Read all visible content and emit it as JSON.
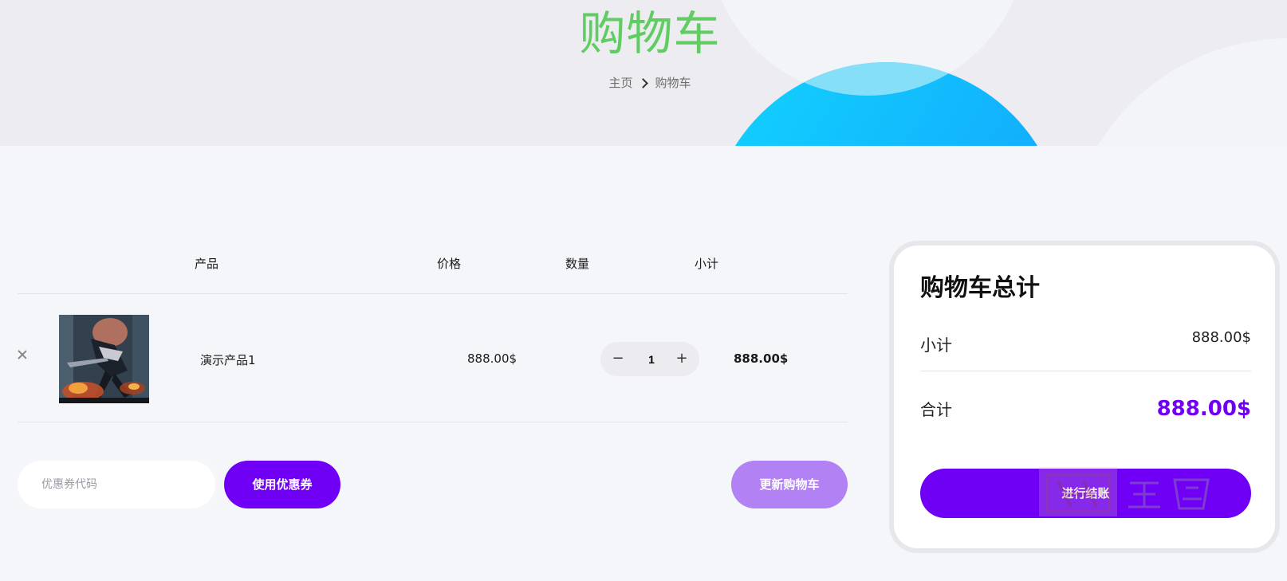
{
  "hero": {
    "title": "购物车",
    "breadcrumb": {
      "home": "主页",
      "current": "购物车"
    }
  },
  "cart": {
    "columns": {
      "product": "产品",
      "price": "价格",
      "quantity": "数量",
      "subtotal": "小计"
    },
    "items": [
      {
        "name": "演示产品1",
        "price": "888.00$",
        "quantity": "1",
        "subtotal": "888.00$"
      }
    ],
    "quantity_minus": "−",
    "quantity_plus": "+",
    "coupon_placeholder": "优惠券代码",
    "apply_coupon_label": "使用优惠券",
    "update_cart_label": "更新购物车"
  },
  "totals": {
    "title": "购物车总计",
    "subtotal_label": "小计",
    "subtotal_value": "888.00$",
    "total_label": "合计",
    "total_value": "888.00$",
    "checkout_label": "进行结账"
  },
  "colors": {
    "hero_title": "#5fcd62",
    "accent": "#7000f5",
    "update_button": "#b281f3",
    "hero_circle": "#12b4fd"
  }
}
